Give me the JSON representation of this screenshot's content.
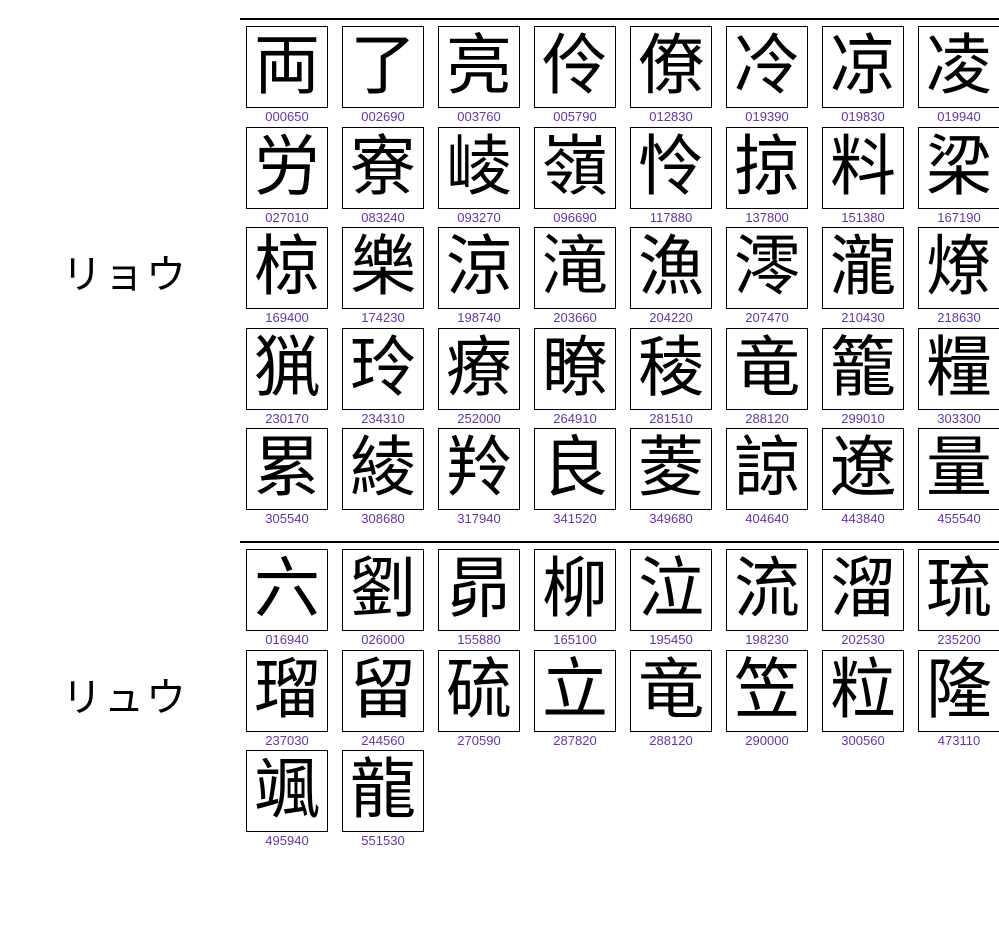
{
  "sections": [
    {
      "reading": "リョウ",
      "items": [
        {
          "kanji": "両",
          "code": "000650"
        },
        {
          "kanji": "了",
          "code": "002690"
        },
        {
          "kanji": "亮",
          "code": "003760"
        },
        {
          "kanji": "伶",
          "code": "005790"
        },
        {
          "kanji": "僚",
          "code": "012830"
        },
        {
          "kanji": "冷",
          "code": "019390"
        },
        {
          "kanji": "凉",
          "code": "019830"
        },
        {
          "kanji": "凌",
          "code": "019940"
        },
        {
          "kanji": "労",
          "code": "027010"
        },
        {
          "kanji": "寮",
          "code": "083240"
        },
        {
          "kanji": "崚",
          "code": "093270"
        },
        {
          "kanji": "嶺",
          "code": "096690"
        },
        {
          "kanji": "怜",
          "code": "117880"
        },
        {
          "kanji": "掠",
          "code": "137800"
        },
        {
          "kanji": "料",
          "code": "151380"
        },
        {
          "kanji": "梁",
          "code": "167190"
        },
        {
          "kanji": "椋",
          "code": "169400"
        },
        {
          "kanji": "樂",
          "code": "174230"
        },
        {
          "kanji": "涼",
          "code": "198740"
        },
        {
          "kanji": "滝",
          "code": "203660"
        },
        {
          "kanji": "漁",
          "code": "204220"
        },
        {
          "kanji": "澪",
          "code": "207470"
        },
        {
          "kanji": "瀧",
          "code": "210430"
        },
        {
          "kanji": "燎",
          "code": "218630"
        },
        {
          "kanji": "猟",
          "code": "230170"
        },
        {
          "kanji": "玲",
          "code": "234310"
        },
        {
          "kanji": "療",
          "code": "252000"
        },
        {
          "kanji": "瞭",
          "code": "264910"
        },
        {
          "kanji": "稜",
          "code": "281510"
        },
        {
          "kanji": "竜",
          "code": "288120"
        },
        {
          "kanji": "籠",
          "code": "299010"
        },
        {
          "kanji": "糧",
          "code": "303300"
        },
        {
          "kanji": "累",
          "code": "305540"
        },
        {
          "kanji": "綾",
          "code": "308680"
        },
        {
          "kanji": "羚",
          "code": "317940"
        },
        {
          "kanji": "良",
          "code": "341520"
        },
        {
          "kanji": "菱",
          "code": "349680"
        },
        {
          "kanji": "諒",
          "code": "404640"
        },
        {
          "kanji": "遼",
          "code": "443840"
        },
        {
          "kanji": "量",
          "code": "455540"
        }
      ]
    },
    {
      "reading": "リュウ",
      "items": [
        {
          "kanji": "六",
          "code": "016940"
        },
        {
          "kanji": "劉",
          "code": "026000"
        },
        {
          "kanji": "昴",
          "code": "155880"
        },
        {
          "kanji": "柳",
          "code": "165100"
        },
        {
          "kanji": "泣",
          "code": "195450"
        },
        {
          "kanji": "流",
          "code": "198230"
        },
        {
          "kanji": "溜",
          "code": "202530"
        },
        {
          "kanji": "琉",
          "code": "235200"
        },
        {
          "kanji": "瑠",
          "code": "237030"
        },
        {
          "kanji": "留",
          "code": "244560"
        },
        {
          "kanji": "硫",
          "code": "270590"
        },
        {
          "kanji": "立",
          "code": "287820"
        },
        {
          "kanji": "竜",
          "code": "288120"
        },
        {
          "kanji": "笠",
          "code": "290000"
        },
        {
          "kanji": "粒",
          "code": "300560"
        },
        {
          "kanji": "隆",
          "code": "473110"
        },
        {
          "kanji": "颯",
          "code": "495940"
        },
        {
          "kanji": "龍",
          "code": "551530"
        }
      ]
    }
  ]
}
